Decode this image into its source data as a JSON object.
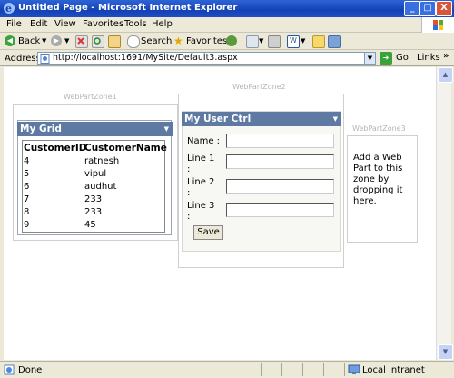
{
  "window": {
    "title": "Untitled Page - Microsoft Internet Explorer",
    "buttons": [
      "_",
      "□",
      "X"
    ]
  },
  "menu": [
    "File",
    "Edit",
    "View",
    "Favorites",
    "Tools",
    "Help"
  ],
  "toolbar": {
    "back": "Back",
    "search": "Search",
    "favorites": "Favorites"
  },
  "address": {
    "label": "Address",
    "url": "http://localhost:1691/MySite/Default3.aspx",
    "go": "Go",
    "links": "Links"
  },
  "zones": {
    "zone1": "WebPartZone1",
    "zone2": "WebPartZone2",
    "zone3": "WebPartZone3"
  },
  "grid": {
    "title": "My Grid",
    "headers": [
      "CustomerID",
      "CustomerName"
    ],
    "rows": [
      [
        "4",
        "ratnesh"
      ],
      [
        "5",
        "vipul"
      ],
      [
        "6",
        "audhut"
      ],
      [
        "7",
        "233"
      ],
      [
        "8",
        "233"
      ],
      [
        "9",
        "45"
      ]
    ]
  },
  "userctrl": {
    "title": "My User Ctrl",
    "name_label": "Name :",
    "line1_label": "Line 1 :",
    "line2_label": "Line 2 :",
    "line3_label": "Line 3 :",
    "save": "Save"
  },
  "zone3_empty": "Add a Web Part to this zone by dropping it here.",
  "status": {
    "text": "Done",
    "zone": "Local intranet"
  },
  "colors": {
    "titlebar": "#1f4fc6",
    "webpart_header": "#5e7aa3",
    "zone_label": "#b6b6b6"
  }
}
